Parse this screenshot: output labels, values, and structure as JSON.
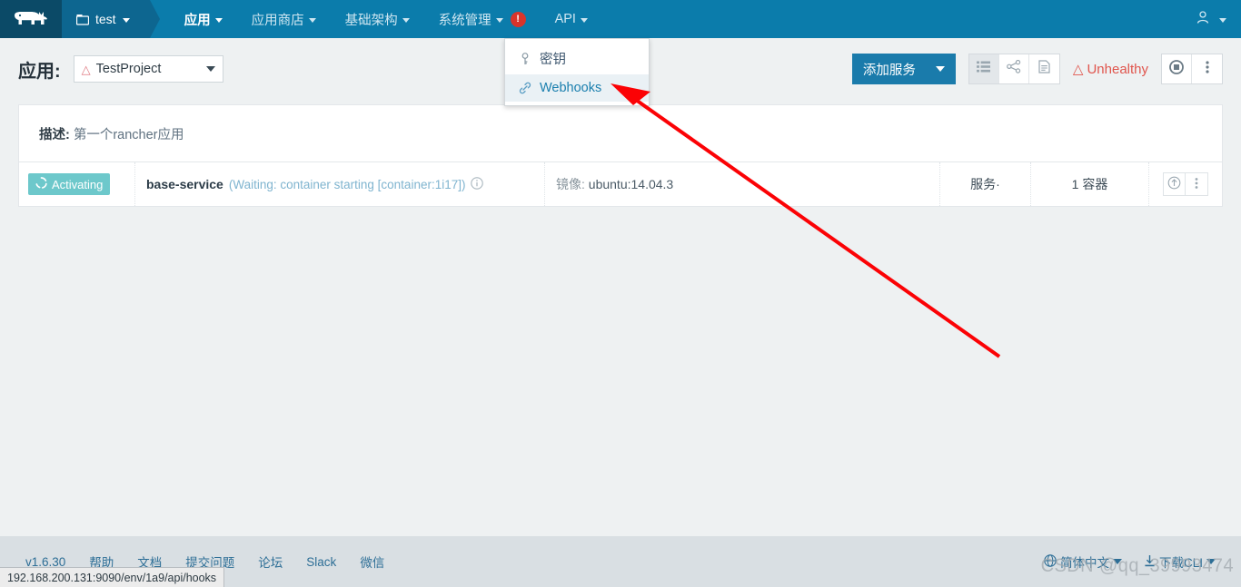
{
  "navbar": {
    "logo_icon": "rancher-cow-logo",
    "environment": {
      "label": "test",
      "icon": "box-icon"
    },
    "items": [
      {
        "label": "应用",
        "active": true,
        "icon": "chevron-down-icon"
      },
      {
        "label": "应用商店",
        "active": false,
        "icon": "chevron-down-icon"
      },
      {
        "label": "基础架构",
        "active": false,
        "icon": "chevron-down-icon"
      },
      {
        "label": "系统管理",
        "active": false,
        "icon": "chevron-down-icon",
        "badge": "!"
      },
      {
        "label": "API",
        "active": false,
        "icon": "chevron-down-icon"
      }
    ],
    "user_icon": "user-icon",
    "user_caret_icon": "chevron-down-icon"
  },
  "dropdown": {
    "items": [
      {
        "label": "密钥",
        "icon": "key-icon",
        "hover": false
      },
      {
        "label": "Webhooks",
        "icon": "link-icon",
        "hover": true
      }
    ]
  },
  "header": {
    "title": "应用:",
    "project": {
      "value": "TestProject",
      "warn_icon": "warning-triangle-icon",
      "caret_icon": "chevron-down-icon"
    },
    "add_service_label": "添加服务",
    "view_buttons": [
      {
        "name": "list-view",
        "icon": "list-icon",
        "active": true
      },
      {
        "name": "graph-view",
        "icon": "share-icon",
        "active": false
      },
      {
        "name": "doc-view",
        "icon": "document-icon",
        "active": false
      }
    ],
    "health_status": "Unhealthy",
    "health_icon": "warning-triangle-icon",
    "stop_icon": "stop-circle-icon",
    "menu_icon": "kebab-menu-icon"
  },
  "description": {
    "label": "描述:",
    "value": "第一个rancher应用"
  },
  "service_row": {
    "state_badge": "Activating",
    "state_icon": "spinner-icon",
    "name": "base-service",
    "status_detail": "(Waiting: container starting [container:1i17])",
    "info_icon": "info-circle-icon",
    "image_label": "镜像:",
    "image_value": "ubuntu:14.04.3",
    "scale": "服务·",
    "containers": "1 容器",
    "upgrade_icon": "upgrade-circle-icon",
    "menu_icon": "kebab-menu-icon"
  },
  "footer": {
    "version": "v1.6.30",
    "links": [
      "帮助",
      "文档",
      "提交问题",
      "论坛",
      "Slack",
      "微信"
    ],
    "language": {
      "label": "简体中文",
      "icon": "globe-icon",
      "caret_icon": "chevron-down-icon"
    },
    "download": {
      "label": "下载CLI",
      "icon": "download-icon",
      "caret_icon": "chevron-down-icon"
    }
  },
  "status_url": "192.168.200.131:9090/env/1a9/api/hooks",
  "watermark": "CSDN @qq_39993474",
  "colors": {
    "nav_blue": "#0b7cab",
    "logo_dark": "#0b4a67",
    "env_blue": "#0d6690",
    "primary_button": "#1a7bab",
    "activating_badge": "#6dc8cb",
    "unhealthy_red": "#e0554d",
    "annotation_red": "#fb0205",
    "footer_bg": "#d9dfe3"
  }
}
